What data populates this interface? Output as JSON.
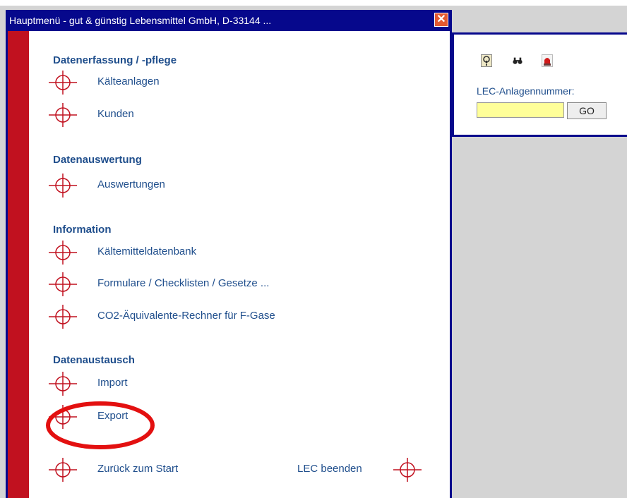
{
  "window": {
    "title": "Hauptmenü - gut & günstig Lebensmittel GmbH, D-33144 ...",
    "close_glyph": "✕"
  },
  "sections": [
    {
      "heading": "Datenerfassung / -pflege",
      "items": [
        {
          "label": "Kälteanlagen"
        },
        {
          "label": "Kunden"
        }
      ]
    },
    {
      "heading": "Datenauswertung",
      "items": [
        {
          "label": "Auswertungen"
        }
      ]
    },
    {
      "heading": "Information",
      "items": [
        {
          "label": "Kältemitteldatenbank"
        },
        {
          "label": "Formulare / Checklisten / Gesetze ..."
        },
        {
          "label": "CO2-Äquivalente-Rechner für F-Gase"
        }
      ]
    },
    {
      "heading": "Datenaustausch",
      "items": [
        {
          "label": "Import"
        },
        {
          "label": "Export"
        }
      ]
    }
  ],
  "footer": {
    "back_label": "Zurück zum Start",
    "exit_label": "LEC beenden"
  },
  "right_panel": {
    "icons": [
      "help-icon",
      "binoculars-icon",
      "alarm-light-icon"
    ],
    "icon_glyphs": [
      "?",
      "⚯",
      "▲"
    ],
    "lec_label": "LEC-Anlagennummer:",
    "lec_value": "",
    "go_label": "GO"
  },
  "colors": {
    "titlebar": "#06088c",
    "accent_red": "#c1111f",
    "link_blue": "#1f4e8c",
    "input_yellow": "#ffff99"
  }
}
